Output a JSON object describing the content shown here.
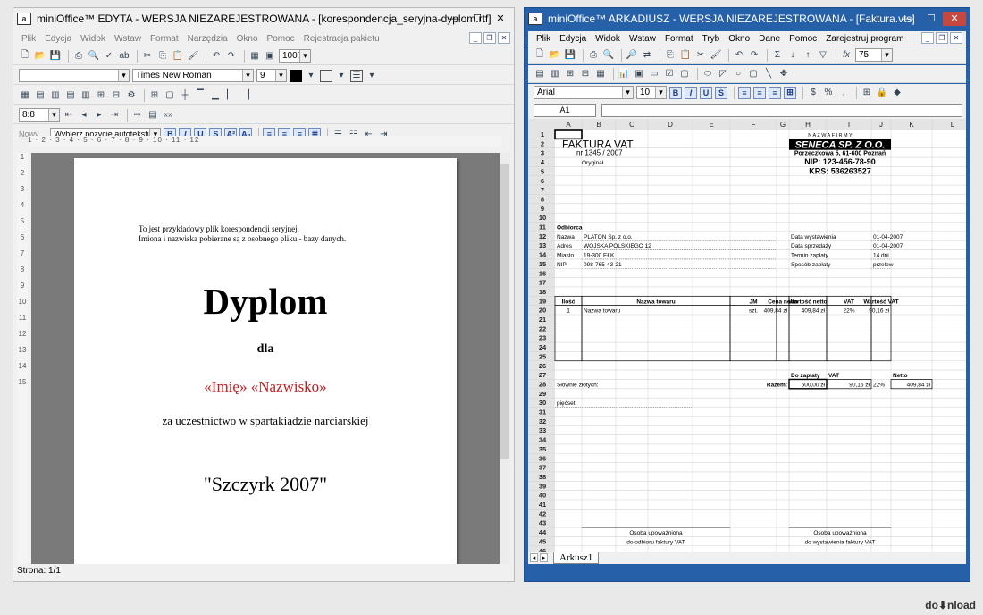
{
  "editor": {
    "title": "miniOffice™  EDYTA - WERSJA NIEZAREJESTROWANA - [korespondencja_seryjna-dyplom.rtf]",
    "menu": [
      "Plik",
      "Edycja",
      "Widok",
      "Wstaw",
      "Format",
      "Narzędzia",
      "Okno",
      "Pomoc",
      "Rejestracja pakietu"
    ],
    "font": "Times New Roman",
    "size": "9",
    "zoom": "100%",
    "spacing": "8:8",
    "style": "Nowy...",
    "autotext": "Wybierz pozycję autotekstu...",
    "ruler": "1 · 2 · 3 · 4 · 5 · 6 · 7 · 8 · 9 · 10 · 11 · 12",
    "status": "Strona: 1/1",
    "page": {
      "intro1": "To jest przykładowy plik korespondencji seryjnej.",
      "intro2": "Imiona i nazwiska pobierane są z osobnego pliku - bazy danych.",
      "heading": "Dyplom",
      "dla": "dla",
      "field_first": "«Imię»",
      "field_last": "«Nazwisko»",
      "reason": "za uczestnictwo w spartakiadzie narciarskiej",
      "event": "\"Szczyrk 2007\""
    }
  },
  "spreadsheet": {
    "title": "miniOffice™  ARKADIUSZ - WERSJA NIEZAREJESTROWANA - [Faktura.vts]",
    "menu": [
      "Plik",
      "Edycja",
      "Widok",
      "Wstaw",
      "Format",
      "Tryb",
      "Okno",
      "Dane",
      "Pomoc",
      "Zarejestruj program"
    ],
    "zoom": "75",
    "font": "Arial",
    "size": "10",
    "cell": "A1",
    "sheet_tab": "Arkusz1",
    "columns": [
      "A",
      "B",
      "C",
      "D",
      "E",
      "F",
      "G",
      "H",
      "I",
      "J",
      "K",
      "L"
    ],
    "invoice": {
      "title": "FAKTURA VAT",
      "number": "nr 1345 / 2007",
      "orig": "Oryginał",
      "label_firm": "N A Z W A   F I R M Y",
      "company": "SENECA SP. Z O.O.",
      "address": "Porzeczkowa 5, 61-600 Poznań",
      "nip": "NIP: 123-456-78-90",
      "krs": "KRS: 536263527",
      "buyer": "Odbiorca",
      "buyer_rows": [
        [
          "Nazwa",
          "PLATON Sp. z o.o."
        ],
        [
          "Adres",
          "WOJSKA POLSKIEGO 12"
        ],
        [
          "Miasto",
          "19-300 EŁK"
        ],
        [
          "NIP",
          "098-765-43-21"
        ]
      ],
      "date_rows": [
        [
          "Data wystawienia",
          "01-04-2007"
        ],
        [
          "Data sprzedaży",
          "01-04-2007"
        ],
        [
          "Termin zapłaty",
          "14 dni"
        ],
        [
          "Sposób zapłaty",
          "przelew"
        ]
      ],
      "table_headers": [
        "Ilość",
        "Nazwa towaru",
        "JM",
        "Cena netto",
        "Wartość netto",
        "VAT",
        "Wartość VAT"
      ],
      "item": [
        "1",
        "Nazwa towaru",
        "szt.",
        "409,84 zł",
        "409,84 zł",
        "22%",
        "90,16 zł"
      ],
      "sum_labels": [
        "Do zapłaty",
        "VAT",
        "Netto"
      ],
      "words_label": "Słownie złotych:",
      "razem": "Razem:",
      "sums": [
        "500,00 zł",
        "90,16 zł",
        "22%",
        "409,84 zł"
      ],
      "words": "pięćset",
      "sig_left": [
        "Osoba upoważniona",
        "do odbioru faktury VAT"
      ],
      "sig_right": [
        "Osoba upoważniona",
        "do wystawienia faktury VAT"
      ]
    }
  },
  "watermark": "do⬇nload"
}
